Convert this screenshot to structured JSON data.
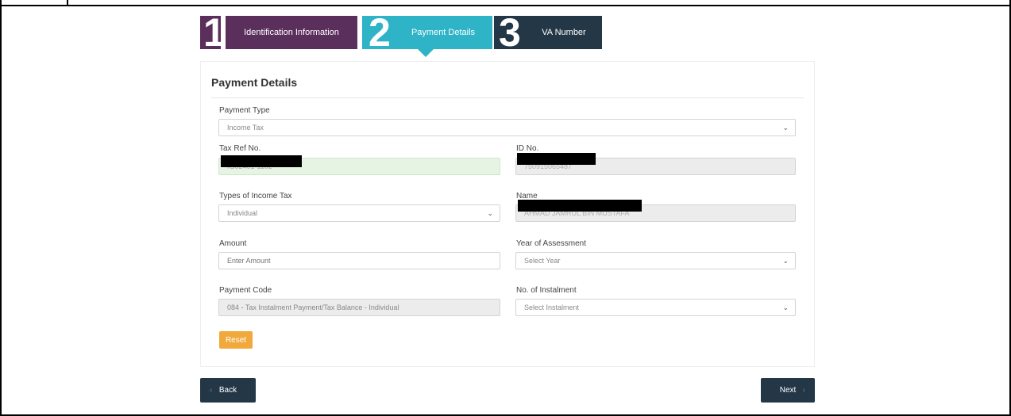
{
  "steps": [
    {
      "number": "1",
      "label": "Identification Information",
      "color": "#5a2f5c"
    },
    {
      "number": "2",
      "label": "Payment Details",
      "color": "#2eb3c7"
    },
    {
      "number": "3",
      "label": "VA Number",
      "color": "#233747"
    }
  ],
  "card": {
    "title": "Payment Details"
  },
  "form": {
    "payment_type": {
      "label": "Payment Type",
      "value": "Income Tax"
    },
    "tax_ref_no": {
      "label": "Tax Ref No.",
      "value": "IG02401-1102"
    },
    "id_no": {
      "label": "ID No.",
      "value": "750915065487"
    },
    "income_tax_type": {
      "label": "Types of Income Tax",
      "value": "Individual"
    },
    "name": {
      "label": "Name",
      "value": "AHMAD JAMRUL BIN MUSTAFA"
    },
    "amount": {
      "label": "Amount",
      "placeholder": "Enter Amount"
    },
    "year_of_assessment": {
      "label": "Year of Assessment",
      "value": "Select Year"
    },
    "payment_code": {
      "label": "Payment Code",
      "value": "084 - Tax Instalment Payment/Tax Balance - Individual"
    },
    "instalment": {
      "label": "No. of Instalment",
      "value": "Select Instalment"
    }
  },
  "buttons": {
    "reset": "Reset",
    "back": "Back",
    "next": "Next"
  },
  "colors": {
    "primary_dark": "#233747",
    "accent_teal": "#2eb3c7",
    "accent_purple": "#5a2f5c",
    "reset_orange": "#f1a93b"
  }
}
